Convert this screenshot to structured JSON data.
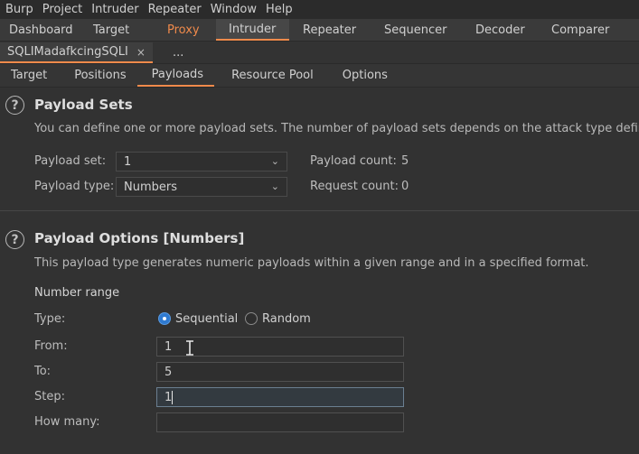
{
  "menubar": {
    "items": [
      "Burp",
      "Project",
      "Intruder",
      "Repeater",
      "Window",
      "Help"
    ]
  },
  "main_tabs": [
    "Dashboard",
    "Target",
    "Proxy",
    "Intruder",
    "Repeater",
    "Sequencer",
    "Decoder",
    "Comparer"
  ],
  "instance_tabs": {
    "active": "SQLIMadafkcingSQLI",
    "close": "×",
    "more": "..."
  },
  "sub_tabs": [
    "Target",
    "Positions",
    "Payloads",
    "Resource Pool",
    "Options"
  ],
  "payload_sets": {
    "help": "?",
    "title": "Payload Sets",
    "description": "You can define one or more payload sets. The number of payload sets depends on the attack type define",
    "set_label": "Payload set:",
    "set_value": "1",
    "type_label": "Payload type:",
    "type_value": "Numbers",
    "count_label": "Payload count:",
    "count_value": "5",
    "request_label": "Request count:",
    "request_value": "0"
  },
  "payload_options": {
    "help": "?",
    "title": "Payload Options [Numbers]",
    "description": "This payload type generates numeric payloads within a given range and in a specified format.",
    "range_heading": "Number range",
    "type_label": "Type:",
    "sequential": "Sequential",
    "random": "Random",
    "from_label": "From:",
    "from_value": "1",
    "to_label": "To:",
    "to_value": "5",
    "step_label": "Step:",
    "step_value": "1",
    "howmany_label": "How many:",
    "howmany_value": ""
  },
  "icons": {
    "chevron": "chevron-down-icon",
    "help": "help-icon",
    "cursor": "text-cursor-icon"
  },
  "colors": {
    "accent": "#f08a4b",
    "radio_selected": "#2f7ad0"
  }
}
